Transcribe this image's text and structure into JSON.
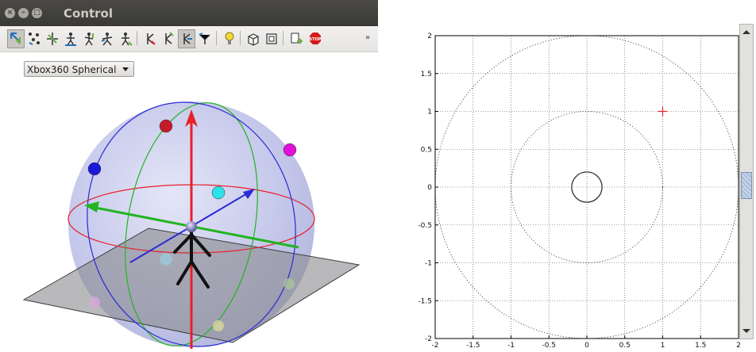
{
  "window": {
    "title": "Control",
    "close_symbol": "×",
    "minimize_symbol": "–",
    "maximize_symbol": "□"
  },
  "toolbar": {
    "tools": [
      {
        "icon": "select-tool-icon",
        "active": true
      },
      {
        "icon": "points-tool-icon"
      },
      {
        "icon": "rotate-tool-icon"
      },
      {
        "icon": "stick-figure-tool-icon"
      },
      {
        "icon": "stick-figure-2-tool-icon"
      },
      {
        "icon": "stick-figure-3-tool-icon"
      },
      {
        "icon": "stick-figure-4-tool-icon"
      },
      {
        "icon": "pose-tool-icon"
      },
      {
        "icon": "pose-2-tool-icon"
      },
      {
        "icon": "pose-3-tool-icon",
        "active": true
      },
      {
        "icon": "pose-4-tool-icon"
      },
      {
        "icon": "lightbulb-icon"
      },
      {
        "icon": "cube-view-icon"
      },
      {
        "icon": "front-view-icon"
      },
      {
        "icon": "export-icon"
      },
      {
        "icon": "stop-icon"
      }
    ],
    "overflow_symbol": "»",
    "stop_label": "STOP"
  },
  "controller_select": {
    "value": "Xbox360 Spherical"
  },
  "colors": {
    "red_axis": "#e8202a",
    "green_axis": "#22b421",
    "blue_axis": "#2a2ad6",
    "sphere_fill": "#b9bde6",
    "marker_red": "#c41a2c",
    "marker_magenta": "#e010d8",
    "marker_blue": "#1a1ad8",
    "marker_cyan": "#2ee0e8",
    "plot_cross": "#e8202a"
  },
  "chart_data": {
    "type": "scatter",
    "xlim": [
      -2,
      2
    ],
    "ylim": [
      -2,
      2
    ],
    "x_ticks": [
      "-2",
      "-1.5",
      "-1",
      "-0.5",
      "0",
      "0.5",
      "1",
      "1.5",
      "2"
    ],
    "y_ticks": [
      "2",
      "1.5",
      "1",
      "0.5",
      "0",
      "-0.5",
      "-1",
      "-1.5",
      "-2"
    ],
    "grid": true,
    "points": [
      {
        "x": 1,
        "y": 1,
        "marker": "+",
        "color": "#e8202a"
      }
    ],
    "circles": [
      {
        "radius": 2,
        "style": "dotted"
      },
      {
        "radius": 1,
        "style": "dotted"
      },
      {
        "radius": 0.2,
        "style": "solid"
      }
    ]
  }
}
